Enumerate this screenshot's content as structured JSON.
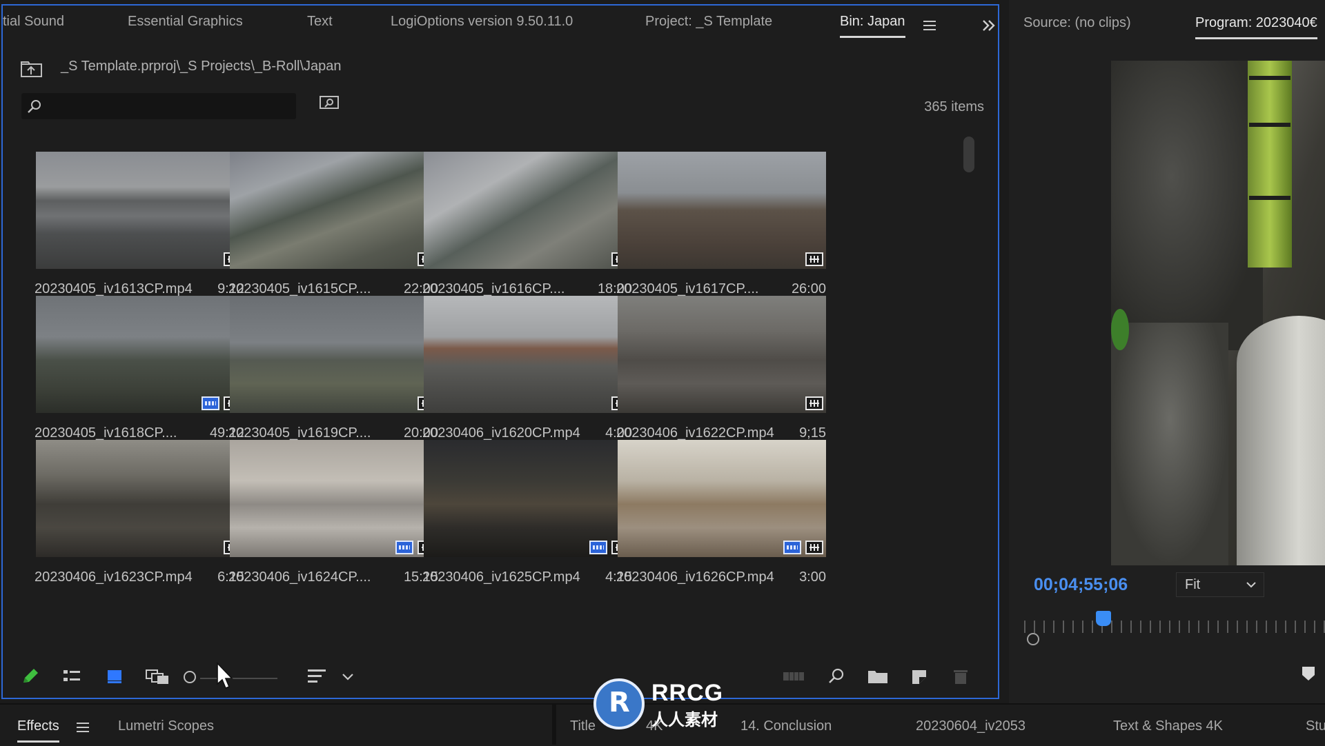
{
  "project_panel": {
    "tabs": [
      {
        "label": "tial Sound",
        "active": false
      },
      {
        "label": "Essential Graphics",
        "active": false
      },
      {
        "label": "Text",
        "active": false
      },
      {
        "label": "LogiOptions version 9.50.11.0",
        "active": false
      },
      {
        "label": "Project: _S Template",
        "active": false
      },
      {
        "label": "Bin: Japan",
        "active": true
      }
    ],
    "overflow_icon": "double-chevron-right-icon",
    "path": "_S Template.prproj\\_S Projects\\_B-Roll\\Japan",
    "search": {
      "placeholder": "",
      "value": ""
    },
    "items_count": "365 items",
    "clips": [
      {
        "name": "20230405_iv1613CP.mp4",
        "duration": "9:12",
        "scene": "stadium",
        "badges": [
          "av"
        ]
      },
      {
        "name": "20230405_iv1615CP....",
        "duration": "22:00",
        "scene": "blur",
        "badges": [
          "av"
        ]
      },
      {
        "name": "20230405_iv1616CP....",
        "duration": "18:00",
        "scene": "blur2",
        "badges": [
          "av"
        ]
      },
      {
        "name": "20230405_iv1617CP....",
        "duration": "26:00",
        "scene": "building",
        "badges": [
          "av"
        ]
      },
      {
        "name": "20230405_iv1618CP....",
        "duration": "49:12",
        "scene": "hills",
        "badges": [
          "video",
          "av"
        ]
      },
      {
        "name": "20230405_iv1619CP....",
        "duration": "20:00",
        "scene": "hills2",
        "badges": [
          "av"
        ]
      },
      {
        "name": "20230406_iv1620CP.mp4",
        "duration": "4:00",
        "scene": "torii",
        "badges": [
          "av"
        ]
      },
      {
        "name": "20230406_iv1622CP.mp4",
        "duration": "9;15",
        "scene": "street",
        "badges": [
          "av"
        ]
      },
      {
        "name": "20230406_iv1623CP.mp4",
        "duration": "6:15",
        "scene": "arcade",
        "badges": [
          "av"
        ]
      },
      {
        "name": "20230406_iv1624CP....",
        "duration": "15:15",
        "scene": "dog",
        "badges": [
          "video",
          "av"
        ]
      },
      {
        "name": "20230406_iv1625CP.mp4",
        "duration": "4:15",
        "scene": "night",
        "badges": [
          "video",
          "av"
        ]
      },
      {
        "name": "20230406_iv1626CP.mp4",
        "duration": "3:00",
        "scene": "shop",
        "badges": [
          "video",
          "av"
        ]
      }
    ],
    "toolbar_icons": [
      "pencil-icon",
      "list-view-icon",
      "icon-view-icon",
      "freeform-view-icon",
      "zoom-slider",
      "sort-icon",
      "chevron-down-icon",
      "automate-icon",
      "find-icon",
      "new-bin-icon",
      "new-item-icon",
      "trash-icon"
    ],
    "zoom_level": 0.05
  },
  "monitor": {
    "source_tab": "Source: (no clips)",
    "program_tab": "Program: 2023040€",
    "timecode": "00;04;55;06",
    "fit": "Fit",
    "marker_icon": "marker-icon"
  },
  "bottom_tabs": {
    "left": [
      {
        "label": "Effects",
        "active": true
      },
      {
        "label": "Lumetri Scopes",
        "active": false
      }
    ],
    "right": [
      "Title",
      "4K",
      "14. Conclusion",
      "20230604_iv2053",
      "Text & Shapes 4K",
      "Stu"
    ]
  },
  "watermark": {
    "title": "RRCG",
    "subtitle": "人人素材"
  },
  "colors": {
    "accent": "#2d68d6",
    "timecode": "#4a8ff0",
    "pencil": "#3fbf3f"
  }
}
